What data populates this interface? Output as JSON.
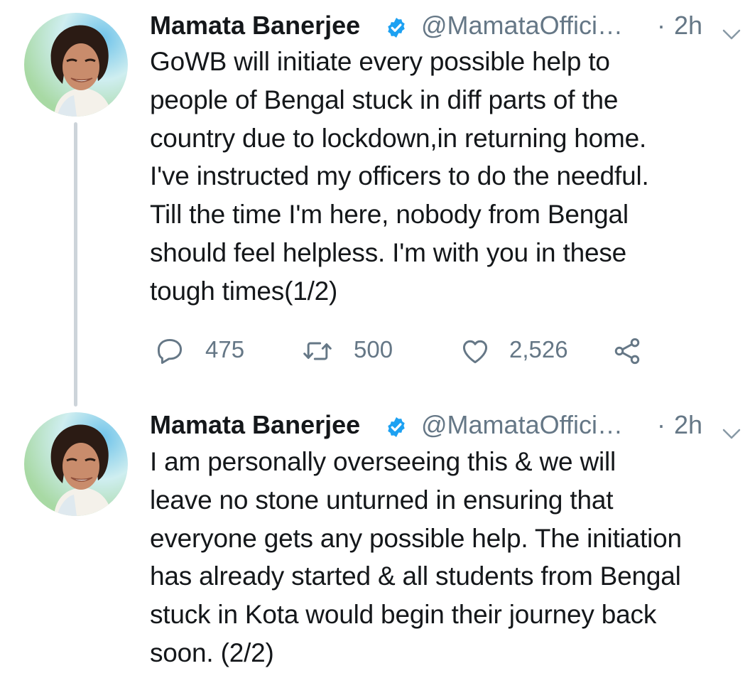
{
  "tweets": [
    {
      "author_name": "Mamata Banerjee",
      "handle": "@MamataOffici…",
      "separator": "·",
      "time": "2h",
      "text_lines": [
        "GoWB will initiate every possible help to",
        "people of Bengal stuck in diff parts of the",
        "country due to lockdown,in returning home.",
        "I've instructed my officers to do the needful.",
        "Till the time I'm here, nobody from Bengal",
        "should feel helpless. I'm with you in these",
        "tough times(1/2)"
      ],
      "replies": "475",
      "retweets": "500",
      "likes": "2,526"
    },
    {
      "author_name": "Mamata Banerjee",
      "handle": "@MamataOffici…",
      "separator": "·",
      "time": "2h",
      "text_lines": [
        "I am personally overseeing this & we will",
        "leave no stone unturned in ensuring that",
        "everyone gets any possible help. The initiation",
        "has already started & all students from Bengal",
        "stuck in Kota would begin their journey back",
        "soon.  (2/2)"
      ]
    }
  ],
  "icons": {
    "verified": "verified-badge-icon",
    "menu": "chevron-down-icon",
    "reply": "reply-icon",
    "retweet": "retweet-icon",
    "like": "heart-icon",
    "share": "share-icon"
  },
  "colors": {
    "text": "#14171a",
    "secondary": "#657786",
    "verified_blue": "#1da1f2",
    "thread_line": "#cdd4da"
  }
}
